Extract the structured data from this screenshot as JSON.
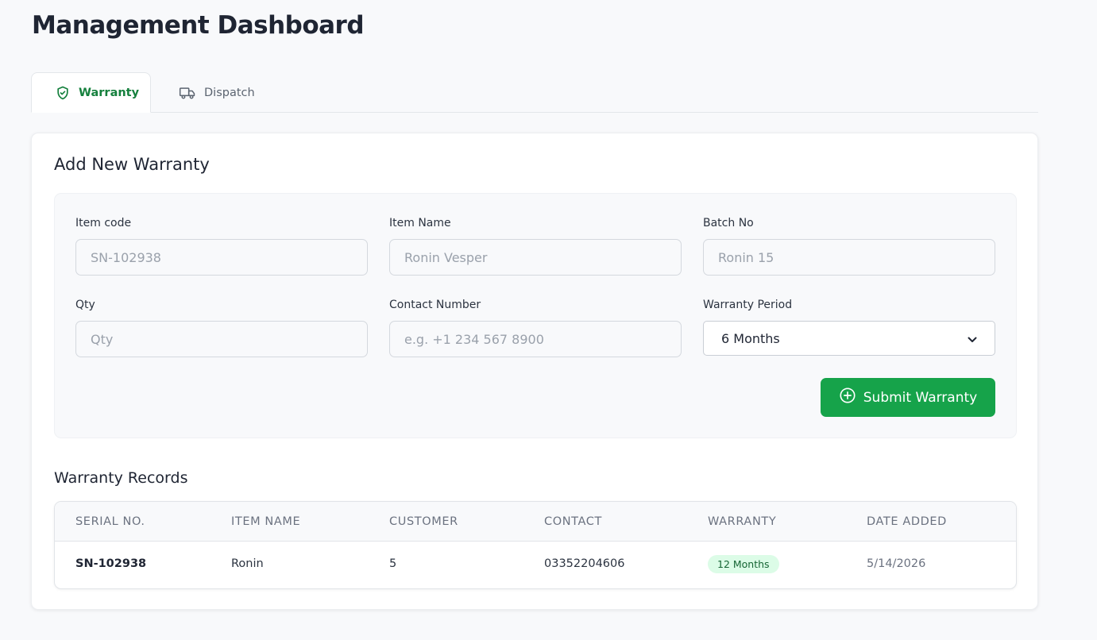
{
  "page": {
    "title": "Management Dashboard"
  },
  "tabs": [
    {
      "label": "Warranty",
      "active": true,
      "icon": "shield-check-icon"
    },
    {
      "label": "Dispatch",
      "active": false,
      "icon": "truck-icon"
    }
  ],
  "form": {
    "title": "Add New Warranty",
    "fields": {
      "item_code": {
        "label": "Item code",
        "placeholder": "SN-102938",
        "value": ""
      },
      "item_name": {
        "label": "Item Name",
        "placeholder": "Ronin Vesper",
        "value": ""
      },
      "batch_no": {
        "label": "Batch No",
        "placeholder": "Ronin 15",
        "value": ""
      },
      "qty": {
        "label": "Qty",
        "placeholder": "Qty",
        "value": ""
      },
      "contact": {
        "label": "Contact Number",
        "placeholder": "e.g. +1 234 567 8900",
        "value": ""
      },
      "warranty_period": {
        "label": "Warranty Period",
        "selected": "6 Months"
      }
    },
    "submit_label": "Submit Warranty"
  },
  "records": {
    "title": "Warranty Records",
    "columns": [
      "Serial No.",
      "Item Name",
      "Customer",
      "Contact",
      "Warranty",
      "Date Added"
    ],
    "rows": [
      {
        "serial": "SN-102938",
        "item_name": "Ronin",
        "customer": "5",
        "contact": "03352204606",
        "warranty": "12 Months",
        "date_added": "5/14/2026"
      }
    ]
  },
  "colors": {
    "accent": "#16a34a",
    "active_tab": "#15803d",
    "badge_bg": "#dcfce7",
    "badge_text": "#166534"
  }
}
